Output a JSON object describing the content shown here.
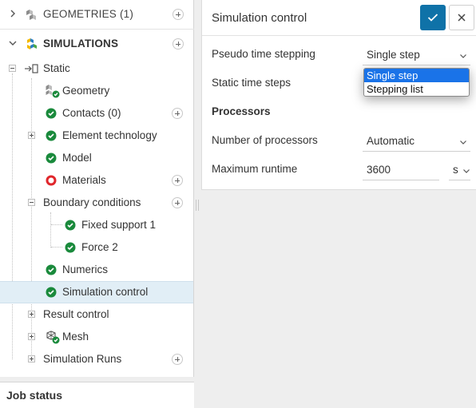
{
  "sidebar": {
    "geometries": {
      "label": "GEOMETRIES (1)"
    },
    "simulations": {
      "label": "SIMULATIONS"
    },
    "tree": {
      "static": "Static",
      "geometry": "Geometry",
      "contacts": "Contacts (0)",
      "element_technology": "Element technology",
      "model": "Model",
      "materials": "Materials",
      "boundary_conditions": "Boundary conditions",
      "fixed_support": "Fixed support 1",
      "force": "Force 2",
      "numerics": "Numerics",
      "simulation_control": "Simulation control",
      "result_control": "Result control",
      "mesh": "Mesh",
      "simulation_runs": "Simulation Runs"
    },
    "job_status": "Job status"
  },
  "panel": {
    "title": "Simulation control",
    "fields": {
      "pseudo_time_stepping": {
        "label": "Pseudo time stepping",
        "value": "Single step"
      },
      "static_time_steps": {
        "label": "Static time steps"
      },
      "processors_heading": "Processors",
      "number_of_processors": {
        "label": "Number of processors",
        "value": "Automatic"
      },
      "maximum_runtime": {
        "label": "Maximum runtime",
        "value": "3600",
        "unit": "s"
      }
    },
    "dropdown": {
      "options": [
        "Single step",
        "Stepping list"
      ],
      "selected": "Single step"
    }
  },
  "colors": {
    "accent": "#0f72a8",
    "ok_green": "#1a8a3c",
    "error_red": "#e0262b",
    "selected_row": "#e1eef6",
    "dropdown_highlight": "#1a73e8"
  }
}
